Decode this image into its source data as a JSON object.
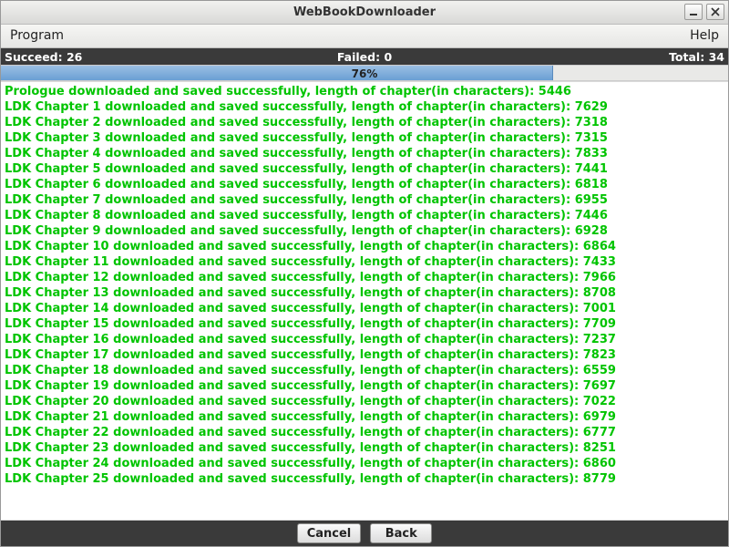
{
  "window": {
    "title": "WebBookDownloader"
  },
  "menubar": {
    "program": "Program",
    "help": "Help"
  },
  "status": {
    "succeed_label": "Succeed:",
    "succeed_value": "26",
    "failed_label": "Failed:",
    "failed_value": "0",
    "total_label": "Total:",
    "total_value": "34"
  },
  "progress": {
    "percent": 76,
    "label": "76%"
  },
  "log": {
    "prefix_prologue": "Prologue downloaded and saved successfully, length of chapter(in characters): ",
    "prefix_chapter": "LDK Chapter {n} downloaded and saved successfully, length of chapter(in characters): ",
    "entries": [
      {
        "name": "Prologue",
        "length": 5446
      },
      {
        "name": "LDK Chapter 1",
        "length": 7629
      },
      {
        "name": "LDK Chapter 2",
        "length": 7318
      },
      {
        "name": "LDK Chapter 3",
        "length": 7315
      },
      {
        "name": "LDK Chapter 4",
        "length": 7833
      },
      {
        "name": "LDK Chapter 5",
        "length": 7441
      },
      {
        "name": "LDK Chapter 6",
        "length": 6818
      },
      {
        "name": "LDK Chapter 7",
        "length": 6955
      },
      {
        "name": "LDK Chapter 8",
        "length": 7446
      },
      {
        "name": "LDK Chapter 9",
        "length": 6928
      },
      {
        "name": "LDK Chapter 10",
        "length": 6864
      },
      {
        "name": "LDK Chapter 11",
        "length": 7433
      },
      {
        "name": "LDK Chapter 12",
        "length": 7966
      },
      {
        "name": "LDK Chapter 13",
        "length": 8708
      },
      {
        "name": "LDK Chapter 14",
        "length": 7001
      },
      {
        "name": "LDK Chapter 15",
        "length": 7709
      },
      {
        "name": "LDK Chapter 16",
        "length": 7237
      },
      {
        "name": "LDK Chapter 17",
        "length": 7823
      },
      {
        "name": "LDK Chapter 18",
        "length": 6559
      },
      {
        "name": "LDK Chapter 19",
        "length": 7697
      },
      {
        "name": "LDK Chapter 20",
        "length": 7022
      },
      {
        "name": "LDK Chapter 21",
        "length": 6979
      },
      {
        "name": "LDK Chapter 22",
        "length": 6777
      },
      {
        "name": "LDK Chapter 23",
        "length": 8251
      },
      {
        "name": "LDK Chapter 24",
        "length": 6860
      },
      {
        "name": "LDK Chapter 25",
        "length": 8779
      }
    ],
    "line_template": "{name} downloaded and saved successfully, length of chapter(in characters): {length}"
  },
  "buttons": {
    "cancel": "Cancel",
    "back": "Back"
  }
}
